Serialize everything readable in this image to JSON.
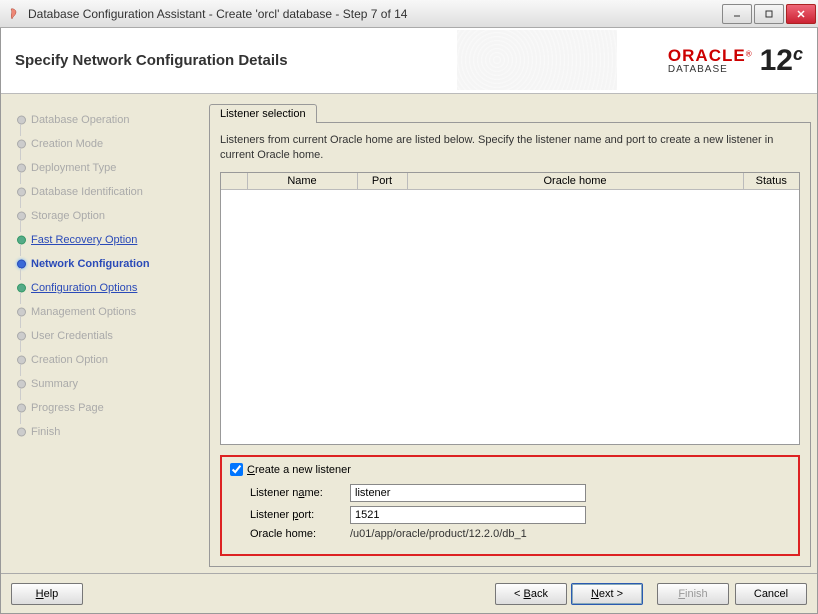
{
  "window": {
    "title": "Database Configuration Assistant - Create 'orcl' database - Step 7 of 14"
  },
  "header": {
    "title": "Specify Network Configuration Details",
    "logo_brand": "ORACLE",
    "logo_sub": "DATABASE",
    "logo_version_main": "12",
    "logo_version_sup": "c"
  },
  "sidebar": {
    "steps": [
      {
        "label": "Database Operation",
        "state": "disabled"
      },
      {
        "label": "Creation Mode",
        "state": "disabled"
      },
      {
        "label": "Deployment Type",
        "state": "disabled"
      },
      {
        "label": "Database Identification",
        "state": "disabled"
      },
      {
        "label": "Storage Option",
        "state": "disabled"
      },
      {
        "label": "Fast Recovery Option",
        "state": "link"
      },
      {
        "label": "Network Configuration",
        "state": "current"
      },
      {
        "label": "Configuration Options",
        "state": "link"
      },
      {
        "label": "Management Options",
        "state": "disabled"
      },
      {
        "label": "User Credentials",
        "state": "disabled"
      },
      {
        "label": "Creation Option",
        "state": "disabled"
      },
      {
        "label": "Summary",
        "state": "disabled"
      },
      {
        "label": "Progress Page",
        "state": "disabled"
      },
      {
        "label": "Finish",
        "state": "disabled"
      }
    ]
  },
  "main": {
    "tab_label": "Listener selection",
    "description": "Listeners from current Oracle home are listed below. Specify the listener name and port to create a new listener in current Oracle home.",
    "columns": {
      "check": "",
      "name": "Name",
      "port": "Port",
      "home": "Oracle home",
      "status": "Status"
    },
    "rows": []
  },
  "form": {
    "checkbox_label": "Create a new listener",
    "checked": true,
    "name_label": "Listener name:",
    "name_value": "listener",
    "port_label": "Listener port:",
    "port_value": "1521",
    "home_label": "Oracle home:",
    "home_value": "/u01/app/oracle/product/12.2.0/db_1"
  },
  "footer": {
    "help": "Help",
    "back": "< Back",
    "next": "Next >",
    "finish": "Finish",
    "cancel": "Cancel"
  }
}
